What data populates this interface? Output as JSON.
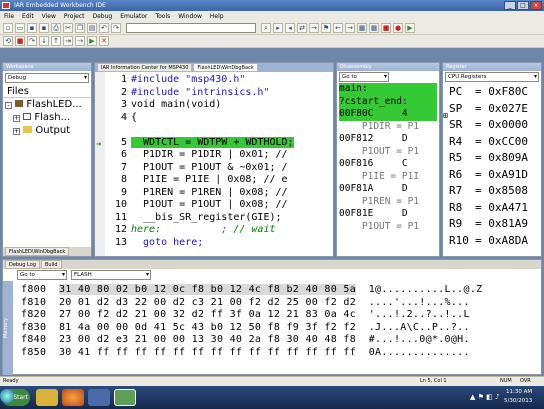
{
  "window": {
    "title": "IAR Embedded Workbench IDE",
    "buttons": [
      "_",
      "□",
      "×"
    ]
  },
  "menu": [
    "File",
    "Edit",
    "View",
    "Project",
    "Debug",
    "Emulator",
    "Tools",
    "Window",
    "Help"
  ],
  "workspace": {
    "header": "Workspace",
    "config": "Debug",
    "files_label": "Files",
    "tree": [
      "FlashLED...",
      "Flash...",
      "Output"
    ],
    "tab": "FlashLED\\WinDbgBack"
  },
  "editor": {
    "tabs": [
      "IAR Information Center for MSP430",
      "FlashLED\\WinDbgBack"
    ],
    "lines": [
      {
        "n": "1",
        "text": "#include \"msp430.h\""
      },
      {
        "n": "2",
        "text": "#include \"intrinsics.h\""
      },
      {
        "n": "3",
        "text": "void main(void)"
      },
      {
        "n": "4",
        "text": "{"
      },
      {
        "n": "5",
        "text": "  WDTCTL = WDTPW + WDTHOLD;"
      },
      {
        "n": "6",
        "text": "  P1DIR = P1DIR | 0x01; //"
      },
      {
        "n": "7",
        "text": "  P1OUT = P1OUT & ~0x01; /"
      },
      {
        "n": "8",
        "text": "  P1IE = P1IE | 0x08; // e"
      },
      {
        "n": "9",
        "text": "  P1REN = P1REN | 0x08; //"
      },
      {
        "n": "10",
        "text": "  P1OUT = P1OUT | 0x08; //"
      },
      {
        "n": "11",
        "text": "  __bis_SR_register(GIE);"
      },
      {
        "n": "12",
        "text": "here:          ; // wait"
      },
      {
        "n": "13",
        "text": "  goto here;"
      }
    ]
  },
  "disassembly": {
    "header": "Disassembly",
    "goto": "Go to",
    "lines": [
      "main:",
      "?cstart_end:",
      "00F80C     4",
      "    P1DIR = P1",
      "00F812     D",
      "    P1OUT = P1",
      "00F816     C",
      "    P1IE = P1I",
      "00F81A     D",
      "    P1REN = P1",
      "00F81E     D",
      "    P1OUT = P1"
    ]
  },
  "registers": {
    "header": "Register",
    "group": "CPU Registers",
    "rows": [
      {
        "name": "PC",
        "value": "= 0xF80C"
      },
      {
        "name": "SP",
        "value": "= 0x027E"
      },
      {
        "name": "SR",
        "value": "= 0x0000"
      },
      {
        "name": "R4",
        "value": "= 0xCC00"
      },
      {
        "name": "R5",
        "value": "= 0x809A"
      },
      {
        "name": "R6",
        "value": "= 0xA91D"
      },
      {
        "name": "R7",
        "value": "= 0x8508"
      },
      {
        "name": "R8",
        "value": "= 0xA471"
      },
      {
        "name": "R9",
        "value": "= 0x81A9"
      },
      {
        "name": "R10",
        "value": "= 0xA8DA"
      }
    ]
  },
  "memory": {
    "tabs": [
      "Debug Log",
      "Build"
    ],
    "goto": "Go to",
    "zone": "FLASH",
    "side_label": "Memory",
    "rows": [
      {
        "addr": "f800",
        "hex": "31 40 80 02 b0 12 0c f8 b0 12 4c f8 b2 40 80 5a",
        "ascii": "1@..........L..@.Z"
      },
      {
        "addr": "f810",
        "hex": "20 01 d2 d3 22 00 d2 c3 21 00 f2 d2 25 00 f2 d2",
        "ascii": "....'...!...%..."
      },
      {
        "addr": "f820",
        "hex": "27 00 f2 d2 21 00 32 d2 ff 3f 0a 12 21 83 0a 4c",
        "ascii": "'...!.2..?..!..L"
      },
      {
        "addr": "f830",
        "hex": "81 4a 00 00 0d 41 5c 43 b0 12 50 f8 f9 3f f2 f2",
        "ascii": ".J...A\\C..P..?.."
      },
      {
        "addr": "f840",
        "hex": "23 00 d2 e3 21 00 00 13 30 40 2a f8 30 40 48 f8",
        "ascii": "#...!...0@*.0@H."
      },
      {
        "addr": "f850",
        "hex": "30 41 ff ff ff ff ff ff ff ff ff ff ff ff ff ff",
        "ascii": "0A.............."
      }
    ]
  },
  "status": {
    "left": "Ready",
    "position": "Ln 5, Col 1",
    "caps": "NUM",
    "ovr": "OVR"
  },
  "taskbar": {
    "start": "Start",
    "time": "11:30 AM",
    "date": "5/30/2013"
  },
  "colors": {
    "highlight": "#35c935",
    "keyword": "#1a1ad0",
    "comment": "#008000"
  }
}
